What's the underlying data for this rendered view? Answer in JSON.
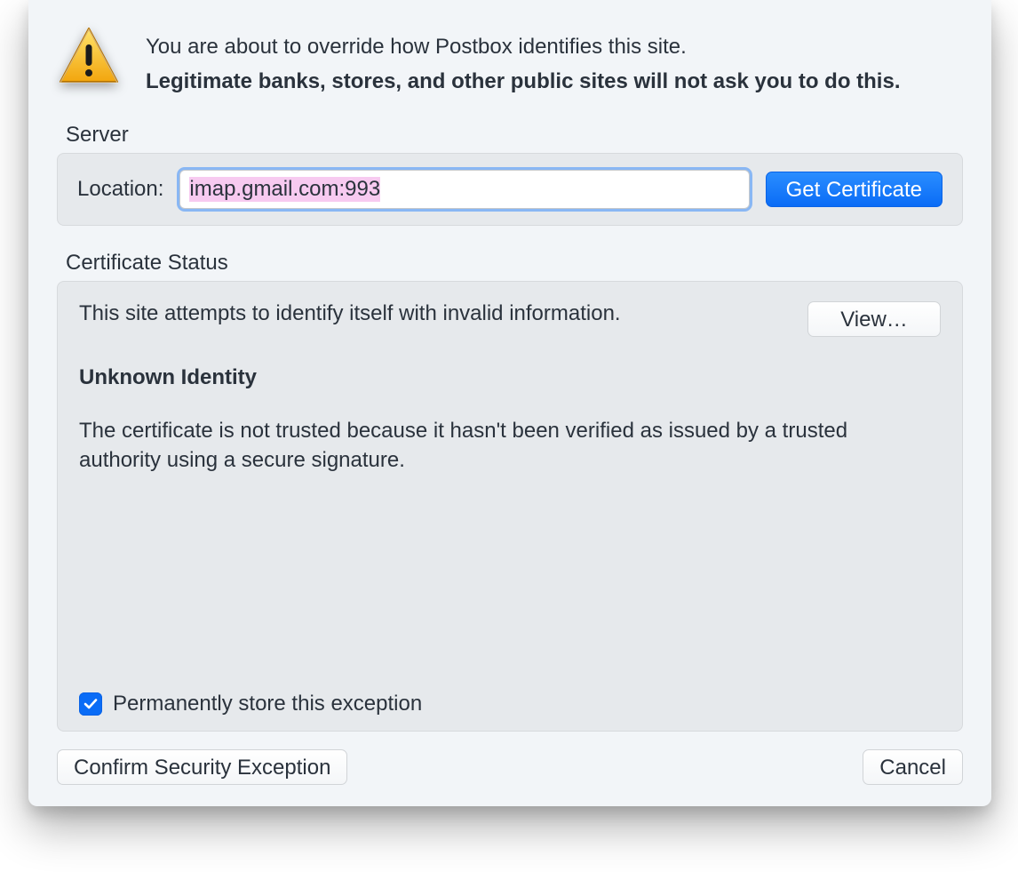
{
  "header": {
    "line1": "You are about to override how Postbox identifies this site.",
    "line2": "Legitimate banks, stores, and other public sites will not ask you to do this."
  },
  "server_group": {
    "legend": "Server",
    "location_label": "Location:",
    "location_value": "imap.gmail.com:993",
    "get_certificate_label": "Get Certificate"
  },
  "cert_group": {
    "legend": "Certificate Status",
    "attempt_text": "This site attempts to identify itself with invalid information.",
    "view_label": "View…",
    "unknown_identity_heading": "Unknown Identity",
    "reason_text": "The certificate is not trusted because it hasn't been verified as issued by a trusted authority using a secure signature.",
    "permanent_store_label": "Permanently store this exception"
  },
  "buttons": {
    "confirm_label": "Confirm Security Exception",
    "cancel_label": "Cancel"
  }
}
